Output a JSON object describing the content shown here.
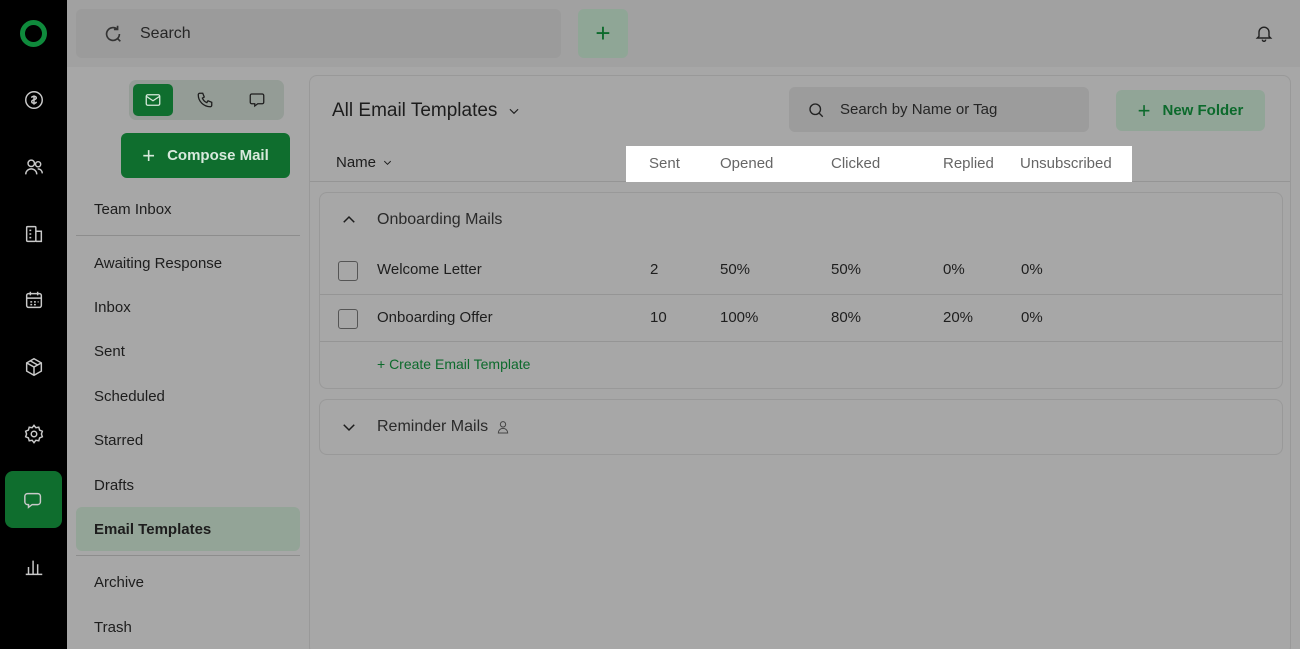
{
  "topbar": {
    "search_label": "Search",
    "add_label": "+"
  },
  "sidebar": {
    "compose_label": "Compose Mail",
    "items": [
      {
        "label": "Team Inbox"
      },
      {
        "label": "Awaiting Response"
      },
      {
        "label": "Inbox"
      },
      {
        "label": "Sent"
      },
      {
        "label": "Scheduled"
      },
      {
        "label": "Starred"
      },
      {
        "label": "Drafts"
      },
      {
        "label": "Email Templates",
        "active": true
      },
      {
        "label": "Archive"
      },
      {
        "label": "Trash"
      }
    ]
  },
  "main": {
    "view_title": "All Email Templates",
    "search_placeholder": "Search by Name or Tag",
    "new_folder_label": "New Folder",
    "columns": {
      "name": "Name",
      "sent": "Sent",
      "opened": "Opened",
      "clicked": "Clicked",
      "replied": "Replied",
      "unsubscribed": "Unsubscribed"
    },
    "groups": [
      {
        "title": "Onboarding Mails",
        "expanded": true,
        "rows": [
          {
            "name": "Welcome Letter",
            "sent": "2",
            "opened": "50%",
            "clicked": "50%",
            "replied": "0%",
            "unsubscribed": "0%"
          },
          {
            "name": "Onboarding Offer",
            "sent": "10",
            "opened": "100%",
            "clicked": "80%",
            "replied": "20%",
            "unsubscribed": "0%"
          }
        ],
        "create_label": "+ Create Email Template"
      },
      {
        "title": "Reminder Mails",
        "expanded": false
      }
    ]
  },
  "colors": {
    "brand": "#0f6e2e",
    "rail": "#000000",
    "overlay_bg": "#a7a7a7",
    "highlight": "#ffffff"
  }
}
